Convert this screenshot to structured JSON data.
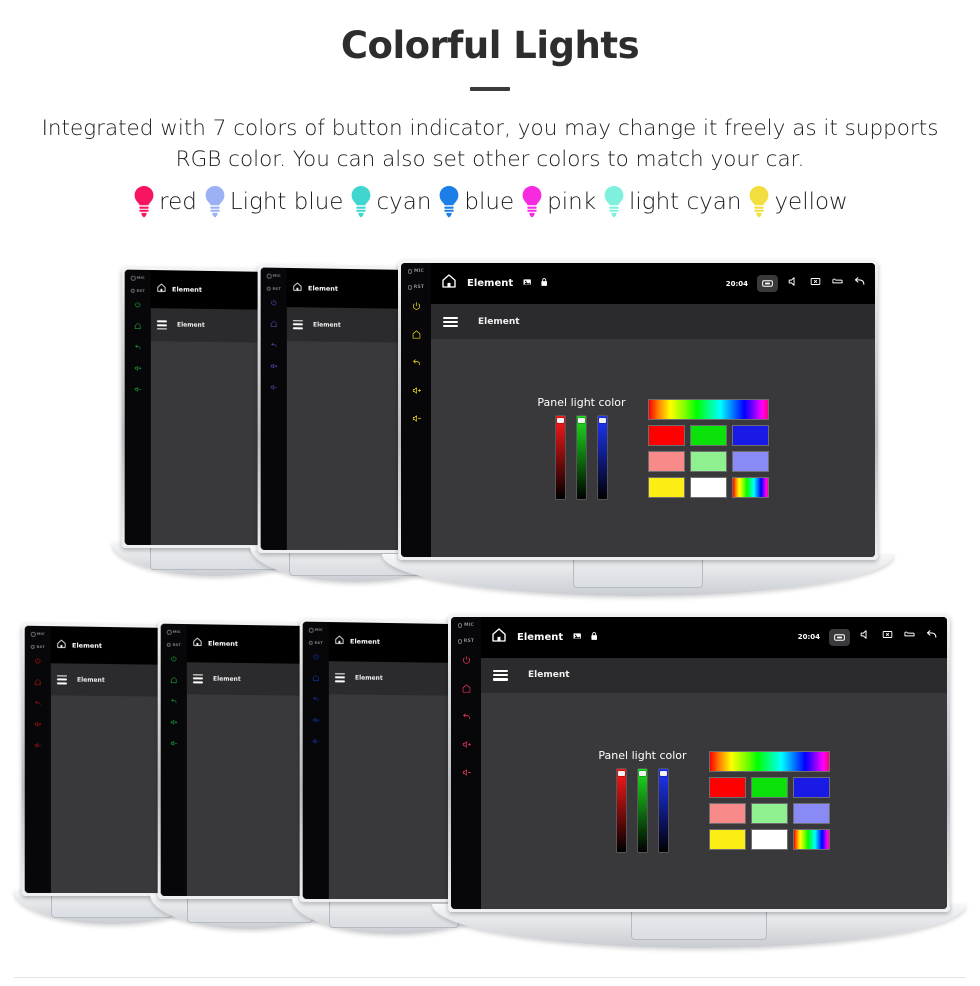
{
  "header": {
    "title": "Colorful Lights",
    "subtitle": "Integrated with 7 colors of button indicator, you may change it freely as it supports RGB color. You can also set other colors to match your car."
  },
  "legend": {
    "items": [
      {
        "label": "red",
        "color": "#f8145e",
        "icon": "bulb-icon"
      },
      {
        "label": "Light blue",
        "color": "#9bb0f5",
        "icon": "bulb-icon"
      },
      {
        "label": "cyan",
        "color": "#3fd6cf",
        "icon": "bulb-icon"
      },
      {
        "label": "blue",
        "color": "#1c7fe8",
        "icon": "bulb-icon"
      },
      {
        "label": "pink",
        "color": "#f72ae0",
        "icon": "bulb-icon"
      },
      {
        "label": "light cyan",
        "color": "#7ff0dd",
        "icon": "bulb-icon"
      },
      {
        "label": "yellow",
        "color": "#f3de3f",
        "icon": "bulb-icon"
      }
    ]
  },
  "stereo": {
    "side_labels": {
      "mic": "MIC",
      "reset": "RST"
    },
    "side_keys": [
      "power-icon",
      "home-icon",
      "back-icon",
      "volume-up-icon",
      "volume-down-icon"
    ],
    "statusbar": {
      "home_icon": "home-icon",
      "app_title": "Element",
      "icons": [
        "image-icon",
        "lock-icon"
      ],
      "time": "20:04",
      "right_icons": [
        "screenshot-icon",
        "mute-icon",
        "close-window-icon",
        "car-icon",
        "back-arrow-icon"
      ]
    },
    "appbar": {
      "menu_icon": "hamburger-icon",
      "title": "Element"
    },
    "panel": {
      "label": "Panel light color",
      "sliders": [
        {
          "name": "red-slider",
          "color": "#ff1a1a"
        },
        {
          "name": "green-slider",
          "color": "#1fe01f"
        },
        {
          "name": "blue-slider",
          "color": "#1f36ff"
        }
      ],
      "swatches": [
        {
          "name": "rainbow-wide-swatch",
          "type": "rainbow",
          "color": ""
        },
        {
          "name": "red-swatch",
          "type": "solid",
          "color": "#ff0000"
        },
        {
          "name": "green-swatch",
          "type": "solid",
          "color": "#0ae20a"
        },
        {
          "name": "blue-swatch",
          "type": "solid",
          "color": "#1a1ae6"
        },
        {
          "name": "salmon-swatch",
          "type": "solid",
          "color": "#f98a8a"
        },
        {
          "name": "light-green-swatch",
          "type": "solid",
          "color": "#8ef08e"
        },
        {
          "name": "periwinkle-swatch",
          "type": "solid",
          "color": "#8a8af5"
        },
        {
          "name": "yellow-swatch",
          "type": "solid",
          "color": "#fcee14"
        },
        {
          "name": "white-swatch",
          "type": "solid",
          "color": "#ffffff"
        },
        {
          "name": "rainbow-small-swatch",
          "type": "rainbow",
          "color": ""
        }
      ]
    }
  },
  "rows": [
    {
      "name": "stereo-row-top",
      "units": [
        {
          "name": "stereo-unit-green",
          "led": "#29d94a",
          "size": "small",
          "screen": "blank"
        },
        {
          "name": "stereo-unit-purple",
          "led": "#7b5cf0",
          "size": "small",
          "screen": "blank"
        },
        {
          "name": "stereo-unit-yellow",
          "led": "#f2e017",
          "size": "large",
          "screen": "panel"
        }
      ]
    },
    {
      "name": "stereo-row-bottom",
      "units": [
        {
          "name": "stereo-unit-red",
          "led": "#e81717",
          "size": "small",
          "screen": "blank"
        },
        {
          "name": "stereo-unit-green",
          "led": "#22d94a",
          "size": "small",
          "screen": "blank"
        },
        {
          "name": "stereo-unit-blue",
          "led": "#1f42e8",
          "size": "small",
          "screen": "blank"
        },
        {
          "name": "stereo-unit-pink",
          "led": "#f0335f",
          "size": "large",
          "screen": "panel"
        }
      ]
    }
  ]
}
